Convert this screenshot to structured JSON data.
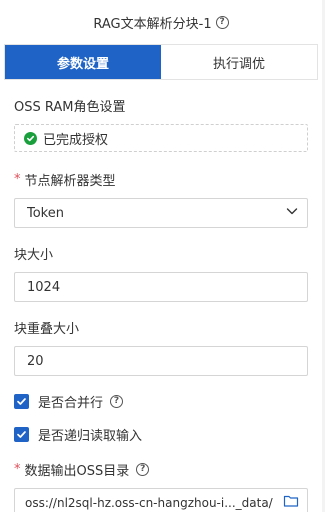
{
  "header": {
    "title": "RAG文本解析分块-1"
  },
  "tabs": [
    {
      "label": "参数设置",
      "active": true
    },
    {
      "label": "执行调优",
      "active": false
    }
  ],
  "oss_ram": {
    "label": "OSS RAM角色设置",
    "status": "已完成授权"
  },
  "parser_type": {
    "required_mark": "*",
    "label": "节点解析器类型",
    "value": "Token"
  },
  "chunk_size": {
    "label": "块大小",
    "value": "1024"
  },
  "chunk_overlap": {
    "label": "块重叠大小",
    "value": "20"
  },
  "checkboxes": [
    {
      "label": "是否合并行",
      "checked": true
    },
    {
      "label": "是否递归读取输入",
      "checked": true
    }
  ],
  "output_dir": {
    "required_mark": "*",
    "label": "数据输出OSS目录",
    "value": "oss://nl2sql-hz.oss-cn-hangzhou-i..._data/"
  },
  "colors": {
    "primary": "#1f63c6",
    "success": "#1a9f3d",
    "required": "#e34d59"
  }
}
